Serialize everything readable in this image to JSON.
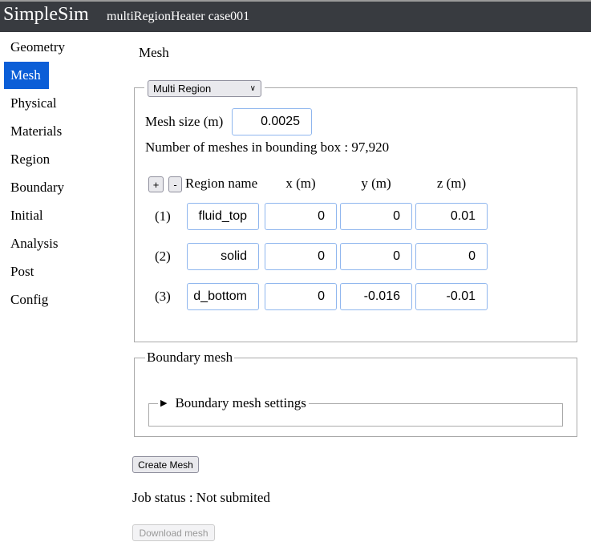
{
  "header": {
    "brand": "SimpleSim",
    "case": "multiRegionHeater case001"
  },
  "sidebar": {
    "items": [
      {
        "label": "Geometry"
      },
      {
        "label": "Mesh",
        "active": true
      },
      {
        "label": "Physical"
      },
      {
        "label": "Materials"
      },
      {
        "label": "Region"
      },
      {
        "label": "Boundary"
      },
      {
        "label": "Initial"
      },
      {
        "label": "Analysis"
      },
      {
        "label": "Post"
      },
      {
        "label": "Config"
      }
    ]
  },
  "main": {
    "title": "Mesh",
    "mode_select": "Multi Region",
    "mesh_size_label": "Mesh size (m)",
    "mesh_size": "0.0025",
    "mesh_count_text": "Number of meshes in bounding box : 97,920",
    "add_label": "+",
    "remove_label": "-",
    "columns": [
      "Region name",
      "x (m)",
      "y (m)",
      "z (m)"
    ],
    "regions": [
      {
        "index": "(1)",
        "name": "fluid_top",
        "x": "0",
        "y": "0",
        "z": "0.01"
      },
      {
        "index": "(2)",
        "name": "solid",
        "x": "0",
        "y": "0",
        "z": "0"
      },
      {
        "index": "(3)",
        "name": "d_bottom",
        "x": "0",
        "y": "-0.016",
        "z": "-0.01"
      }
    ],
    "boundary_legend": "Boundary mesh",
    "boundary_settings": "Boundary mesh settings",
    "create_button": "Create Mesh",
    "job_status": "Job status : Not submited",
    "download_button": "Download mesh"
  }
}
